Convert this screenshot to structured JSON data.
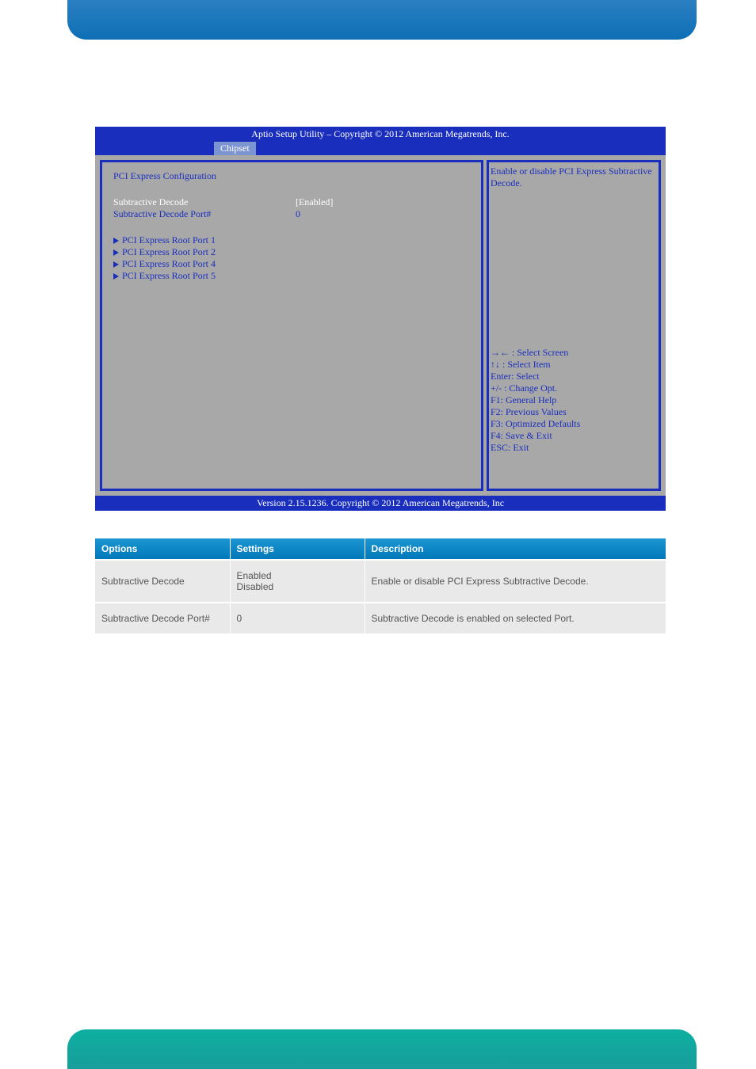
{
  "top_banner": {},
  "bios": {
    "title": "Aptio Setup Utility  –  Copyright © 2012 American Megatrends, Inc.",
    "tab": "Chipset",
    "section_header": "PCI Express Configuration",
    "settings": [
      {
        "label": "Subtractive Decode",
        "value": "[Enabled]",
        "style": "white"
      },
      {
        "label": "Subtractive Decode Port#",
        "value": "0",
        "style": "blue"
      }
    ],
    "submenus": [
      "PCI Express Root Port 1",
      "PCI Express Root Port 2",
      "PCI Express Root Port 4",
      "PCI Express Root Port 5"
    ],
    "help": "Enable or disable PCI Express Subtractive Decode.",
    "nav": [
      "→← : Select Screen",
      "↑↓ : Select Item",
      "Enter: Select",
      "+/- : Change Opt.",
      "F1: General Help",
      "F2: Previous Values",
      "F3: Optimized Defaults",
      "F4: Save & Exit",
      "ESC: Exit"
    ],
    "footer": "Version 2.15.1236. Copyright © 2012 American Megatrends, Inc"
  },
  "table": {
    "headers": [
      "Options",
      "Settings",
      "Description"
    ],
    "rows": [
      [
        "Subtractive Decode",
        "Enabled\nDisabled",
        "Enable or disable PCI Express Subtractive Decode."
      ],
      [
        "Subtractive Decode Port#",
        "0",
        "Subtractive Decode is enabled on selected Port."
      ]
    ]
  },
  "chart_data": {
    "type": "table",
    "title": "PCI Express Configuration Options",
    "columns": [
      "Options",
      "Settings",
      "Description"
    ],
    "rows": [
      {
        "Options": "Subtractive Decode",
        "Settings": "Enabled / Disabled",
        "Description": "Enable or disable PCI Express Subtractive Decode."
      },
      {
        "Options": "Subtractive Decode Port#",
        "Settings": "0",
        "Description": "Subtractive Decode is enabled on selected Port."
      }
    ]
  }
}
